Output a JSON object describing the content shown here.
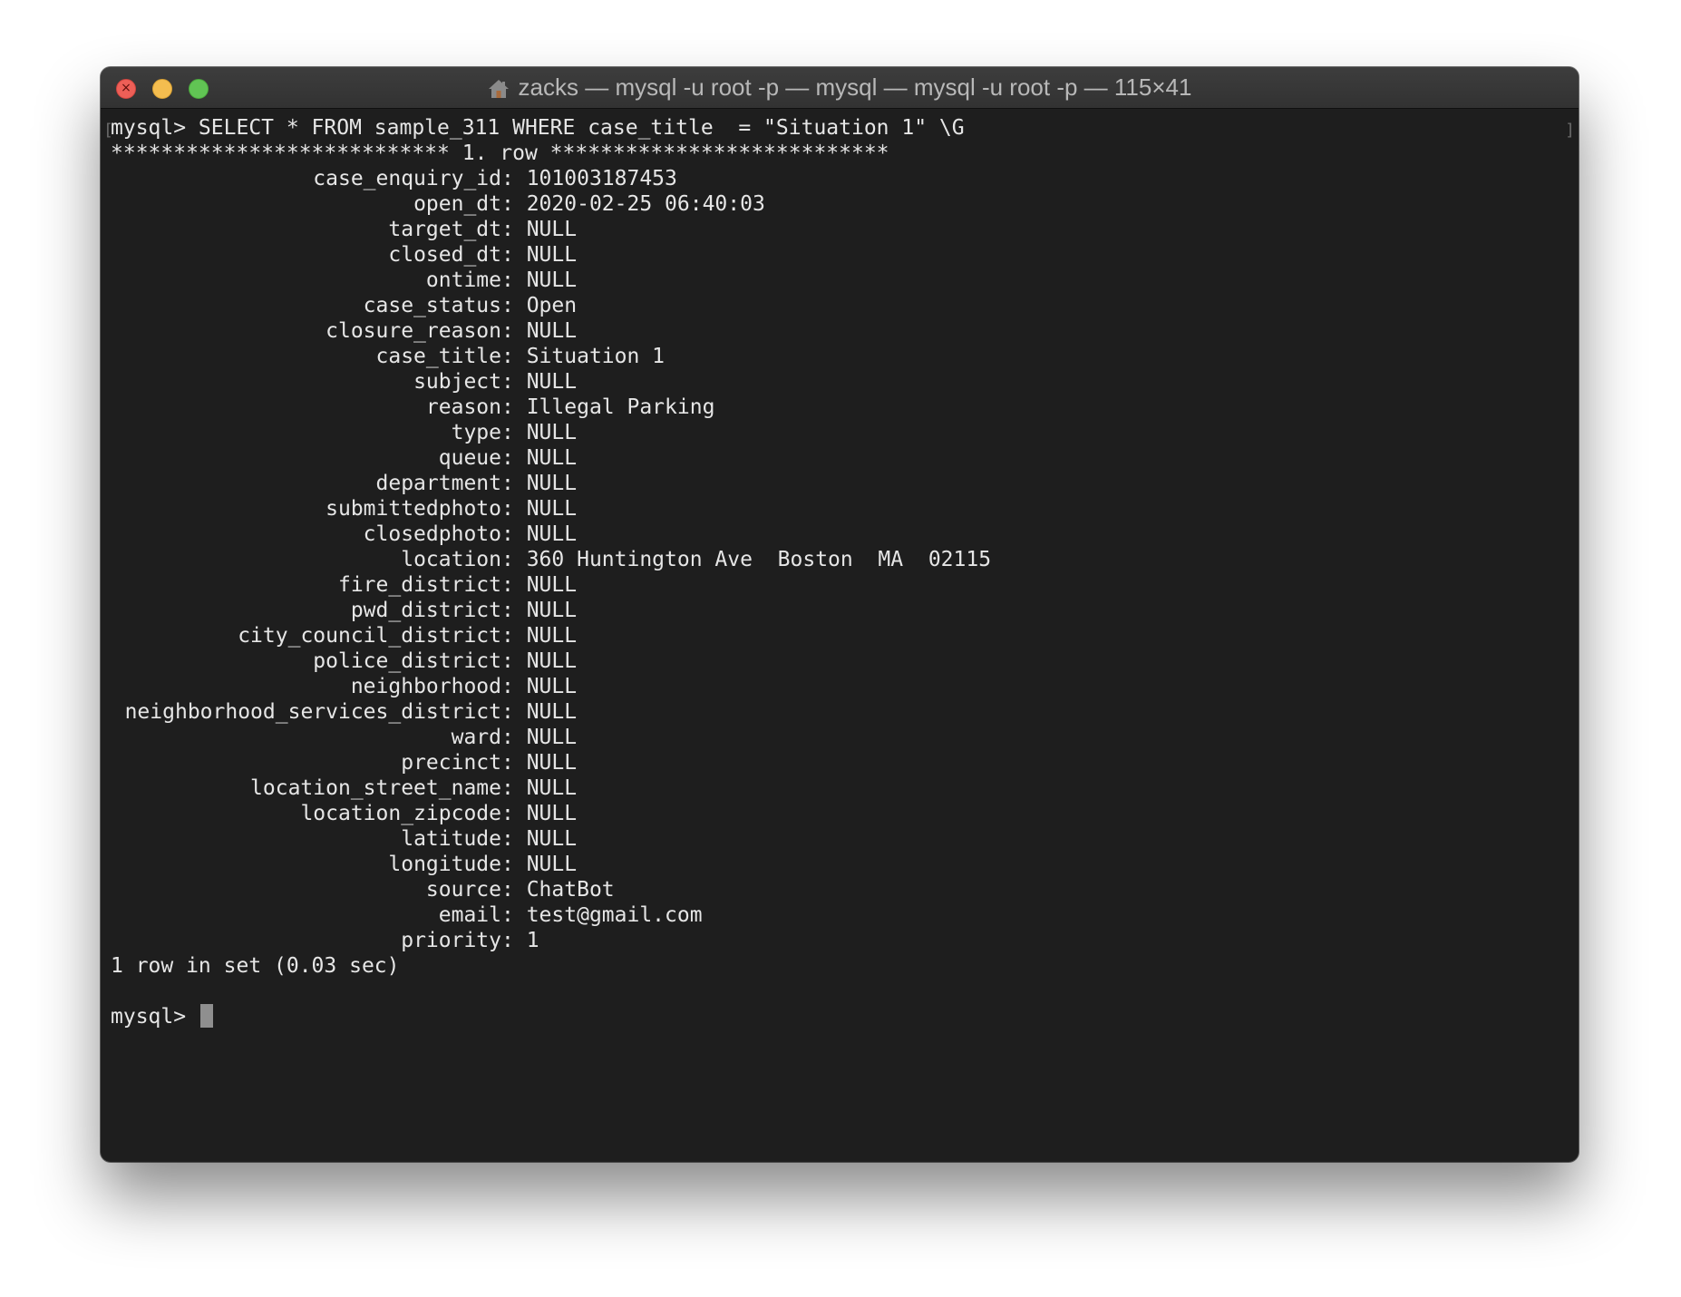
{
  "window": {
    "title": "zacks — mysql -u root -p — mysql — mysql -u root -p — 115×41",
    "title_icon": "home-folder-icon"
  },
  "terminal": {
    "command_line": "mysql> SELECT * FROM sample_311 WHERE case_title  = \"Situation 1\" \\G",
    "row_header": "*************************** 1. row ***************************",
    "fields": [
      {
        "name": "case_enquiry_id",
        "value": "101003187453"
      },
      {
        "name": "open_dt",
        "value": "2020-02-25 06:40:03"
      },
      {
        "name": "target_dt",
        "value": "NULL"
      },
      {
        "name": "closed_dt",
        "value": "NULL"
      },
      {
        "name": "ontime",
        "value": "NULL"
      },
      {
        "name": "case_status",
        "value": "Open"
      },
      {
        "name": "closure_reason",
        "value": "NULL"
      },
      {
        "name": "case_title",
        "value": "Situation 1"
      },
      {
        "name": "subject",
        "value": "NULL"
      },
      {
        "name": "reason",
        "value": "Illegal Parking"
      },
      {
        "name": "type",
        "value": "NULL"
      },
      {
        "name": "queue",
        "value": "NULL"
      },
      {
        "name": "department",
        "value": "NULL"
      },
      {
        "name": "submittedphoto",
        "value": "NULL"
      },
      {
        "name": "closedphoto",
        "value": "NULL"
      },
      {
        "name": "location",
        "value": "360 Huntington Ave  Boston  MA  02115"
      },
      {
        "name": "fire_district",
        "value": "NULL"
      },
      {
        "name": "pwd_district",
        "value": "NULL"
      },
      {
        "name": "city_council_district",
        "value": "NULL"
      },
      {
        "name": "police_district",
        "value": "NULL"
      },
      {
        "name": "neighborhood",
        "value": "NULL"
      },
      {
        "name": "neighborhood_services_district",
        "value": "NULL"
      },
      {
        "name": "ward",
        "value": "NULL"
      },
      {
        "name": "precinct",
        "value": "NULL"
      },
      {
        "name": "location_street_name",
        "value": "NULL"
      },
      {
        "name": "location_zipcode",
        "value": "NULL"
      },
      {
        "name": "latitude",
        "value": "NULL"
      },
      {
        "name": "longitude",
        "value": "NULL"
      },
      {
        "name": "source",
        "value": "ChatBot"
      },
      {
        "name": "email",
        "value": "test@gmail.com"
      },
      {
        "name": "priority",
        "value": "1"
      }
    ],
    "result_summary": "1 row in set (0.03 sec)",
    "prompt": "mysql> "
  }
}
